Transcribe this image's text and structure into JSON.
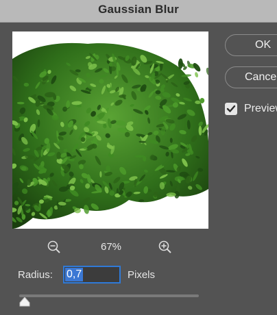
{
  "dialog": {
    "title": "Gaussian Blur",
    "ok_label": "OK",
    "cancel_label": "Cancel",
    "preview_label": "Preview",
    "preview_checked": true
  },
  "zoom": {
    "level": "67%",
    "zoom_out_icon": "zoom-out-icon",
    "zoom_in_icon": "zoom-in-icon"
  },
  "radius": {
    "label": "Radius:",
    "value": "0,7",
    "unit": "Pixels",
    "slider_fraction": 0.0
  },
  "colors": {
    "dialog_bg": "#535353",
    "title_bar": "#b9b9b9",
    "input_focus": "#2f7ad8",
    "selection": "#3b78d4",
    "foliage_dark": "#1f4d12",
    "foliage_mid": "#3f8a22",
    "foliage_light": "#7cc04a"
  }
}
